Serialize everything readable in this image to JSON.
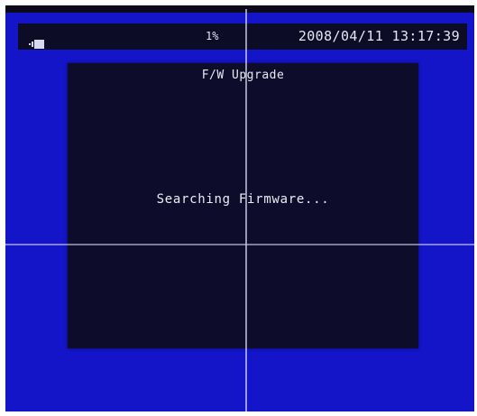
{
  "status_bar": {
    "icon": "record-icon",
    "percent": "1%",
    "datetime": "2008/04/11 13:17:39"
  },
  "dialog": {
    "title": "F/W Upgrade",
    "message": "Searching Firmware..."
  },
  "colors": {
    "screen_background": "#1414c8",
    "dialog_background": "#0d0d2b",
    "status_bar_background": "#0c0c26",
    "text": "#e8e8f2"
  }
}
